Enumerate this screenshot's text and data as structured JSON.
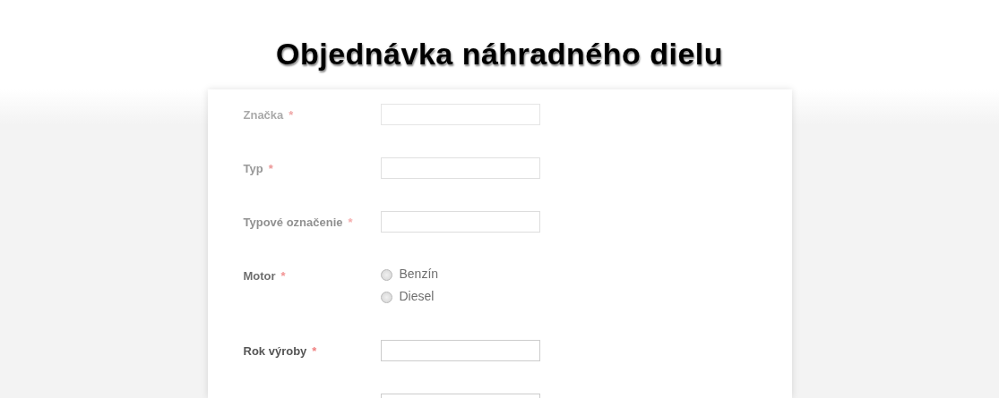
{
  "title": "Objednávka náhradného dielu",
  "fields": [
    {
      "kind": "text",
      "label": "Značka",
      "required_mark": "*"
    },
    {
      "kind": "text",
      "label": "Typ",
      "required_mark": "*"
    },
    {
      "kind": "text",
      "label": "Typové označenie",
      "required_mark": "*"
    },
    {
      "kind": "radio",
      "label": "Motor",
      "required_mark": "*",
      "options": [
        {
          "label": "Benzín",
          "selected": false
        },
        {
          "label": "Diesel",
          "selected": false
        }
      ]
    },
    {
      "kind": "text",
      "label": "Rok výroby",
      "required_mark": "*"
    },
    {
      "kind": "text"
    }
  ]
}
